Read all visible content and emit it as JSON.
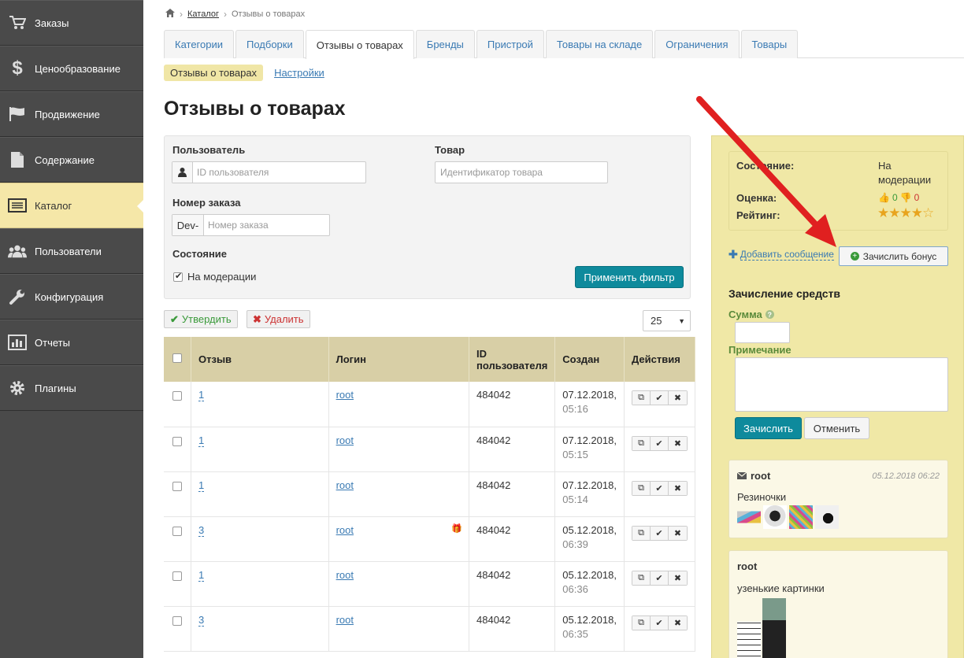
{
  "sidebar": {
    "items": [
      {
        "label": "Заказы",
        "icon": "cart-icon"
      },
      {
        "label": "Ценообразование",
        "icon": "dollar-icon"
      },
      {
        "label": "Продвижение",
        "icon": "flag-icon"
      },
      {
        "label": "Содержание",
        "icon": "document-icon"
      },
      {
        "label": "Каталог",
        "icon": "list-icon"
      },
      {
        "label": "Пользователи",
        "icon": "users-icon"
      },
      {
        "label": "Конфигурация",
        "icon": "wrench-icon"
      },
      {
        "label": "Отчеты",
        "icon": "chart-icon"
      },
      {
        "label": "Плагины",
        "icon": "gear-icon"
      }
    ]
  },
  "breadcrumb": {
    "catalog": "Каталог",
    "current": "Отзывы о товарах"
  },
  "tabs": [
    "Категории",
    "Подборки",
    "Отзывы о товарах",
    "Бренды",
    "Пристрой",
    "Товары на складе",
    "Ограничения",
    "Товары"
  ],
  "subtabs": {
    "active": "Отзывы о товарах",
    "settings": "Настройки"
  },
  "page_title": "Отзывы о товарах",
  "filter": {
    "user_label": "Пользователь",
    "user_placeholder": "ID пользователя",
    "product_label": "Товар",
    "product_placeholder": "Идентификатор товара",
    "order_label": "Номер заказа",
    "order_prefix": "Dev-",
    "order_placeholder": "Номер заказа",
    "state_label": "Состояние",
    "state_option": "На модерации",
    "apply": "Применить фильтр"
  },
  "toolbar": {
    "approve": "Утвердить",
    "delete": "Удалить",
    "per_page": "25"
  },
  "table": {
    "headers": [
      "Отзыв",
      "Логин",
      "ID пользователя",
      "Создан",
      "Действия"
    ],
    "rows": [
      {
        "review": "1",
        "login": "root",
        "user_id": "484042",
        "date": "07.12.2018,",
        "time": "05:16",
        "gift": false
      },
      {
        "review": "1",
        "login": "root",
        "user_id": "484042",
        "date": "07.12.2018,",
        "time": "05:15",
        "gift": false
      },
      {
        "review": "1",
        "login": "root",
        "user_id": "484042",
        "date": "07.12.2018,",
        "time": "05:14",
        "gift": false
      },
      {
        "review": "3",
        "login": "root",
        "user_id": "484042",
        "date": "05.12.2018,",
        "time": "06:39",
        "gift": true
      },
      {
        "review": "1",
        "login": "root",
        "user_id": "484042",
        "date": "05.12.2018,",
        "time": "06:36",
        "gift": false
      },
      {
        "review": "3",
        "login": "root",
        "user_id": "484042",
        "date": "05.12.2018,",
        "time": "06:35",
        "gift": false
      }
    ]
  },
  "panel": {
    "state_label": "Состояние:",
    "state_value_1": "На",
    "state_value_2": "модерации",
    "score_label": "Оценка:",
    "likes": "0",
    "dislikes": "0",
    "rating_label": "Рейтинг:",
    "rating": 4,
    "rating_max": 5,
    "add_message": "Добавить сообщение",
    "bonus_button": "Зачислить бонус",
    "funds_title": "Зачисление средств",
    "sum_label": "Сумма",
    "note_label": "Примечание",
    "submit": "Зачислить",
    "cancel": "Отменить",
    "comments": [
      {
        "author": "root",
        "date": "05.12.2018 06:22",
        "text": "Резиночки"
      },
      {
        "author": "root",
        "date": "",
        "text": "узенькие картинки"
      }
    ]
  },
  "colors": {
    "accent": "#0e8a9c",
    "arrow": "#e02020",
    "panel": "#f0e8a6",
    "sidebar": "#4a4a4a"
  }
}
